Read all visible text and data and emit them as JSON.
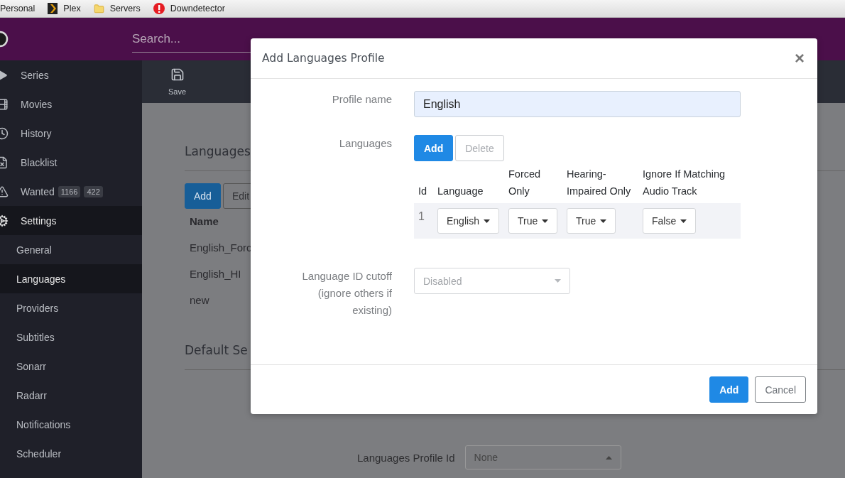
{
  "bookmarks": [
    {
      "label": "Personal"
    },
    {
      "label": "Plex"
    },
    {
      "label": "Servers"
    },
    {
      "label": "Downdetector"
    }
  ],
  "header": {
    "search_placeholder": "Search..."
  },
  "sidebar": {
    "items": [
      {
        "label": "Series",
        "selected": false
      },
      {
        "label": "Movies",
        "selected": false
      },
      {
        "label": "History",
        "selected": false
      },
      {
        "label": "Blacklist",
        "selected": false
      },
      {
        "label": "Wanted",
        "selected": false,
        "badges": [
          "1166",
          "422"
        ]
      },
      {
        "label": "Settings",
        "selected": true,
        "children": [
          {
            "label": "General",
            "selected": false
          },
          {
            "label": "Languages",
            "selected": true
          },
          {
            "label": "Providers",
            "selected": false
          },
          {
            "label": "Subtitles",
            "selected": false
          },
          {
            "label": "Sonarr",
            "selected": false
          },
          {
            "label": "Radarr",
            "selected": false
          },
          {
            "label": "Notifications",
            "selected": false
          },
          {
            "label": "Scheduler",
            "selected": false
          }
        ]
      }
    ]
  },
  "toolbar": {
    "buttons": [
      {
        "label": "Save"
      }
    ]
  },
  "background": {
    "heading": "Languages",
    "buttons": [
      "Add",
      "Edit"
    ],
    "table_header": "Name",
    "rows": [
      "English_Forc",
      "English_HI",
      "new"
    ],
    "section_heading": "Default Se",
    "profile_label": "Languages Profile Id",
    "profile_value": "None"
  },
  "modal": {
    "title": "Add Languages Profile",
    "close": "×",
    "profile_name": {
      "label": "Profile name",
      "value": "English"
    },
    "languages": {
      "label": "Languages",
      "add": "Add",
      "delete": "Delete",
      "delete_disabled": true,
      "columns": [
        "Id",
        "Language",
        "Forced Only",
        "Hearing-Impaired Only",
        "Ignore If Matching Audio Track"
      ],
      "rows": [
        {
          "id": "1",
          "language": "English",
          "forced": "True",
          "hi": "True",
          "audio": "False"
        }
      ]
    },
    "cutoff": {
      "label": "Language ID cutoff (ignore others if existing)",
      "value": "Disabled"
    },
    "footer": [
      "Add",
      "Cancel"
    ]
  }
}
